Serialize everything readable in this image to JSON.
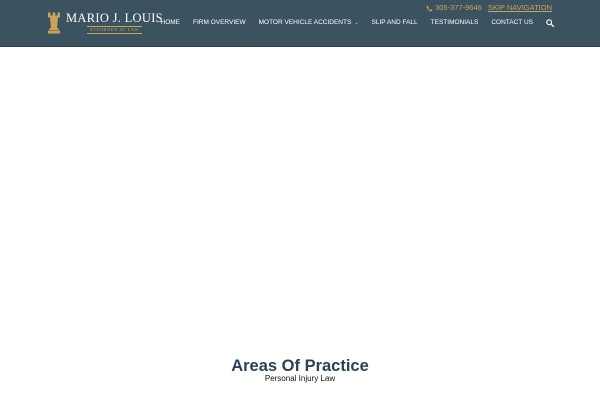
{
  "logo": {
    "name": "MARIO J. LOUIS",
    "tagline": "ATTORNEY AT LAW",
    "mark_icon": "chess-rook-icon"
  },
  "topbar": {
    "phone": "305-377-9646",
    "phone_icon": "phone-icon",
    "skip_link": "SKIP NAVIGATION"
  },
  "nav": {
    "items": [
      {
        "label": "HOME"
      },
      {
        "label": "FIRM OVERVIEW"
      },
      {
        "label": "MOTOR VEHICLE ACCIDENTS",
        "has_dropdown": true
      },
      {
        "label": "SLIP AND FALL"
      },
      {
        "label": "TESTIMONIALS"
      },
      {
        "label": "CONTACT US"
      }
    ],
    "search_icon": "search-icon"
  },
  "main": {
    "title": "Areas Of Practice",
    "subtitle": "Personal Injury Law"
  },
  "colors": {
    "header_bg": "#3b5260",
    "accent_gold": "#c9a55a",
    "title_color": "#2d4151"
  }
}
